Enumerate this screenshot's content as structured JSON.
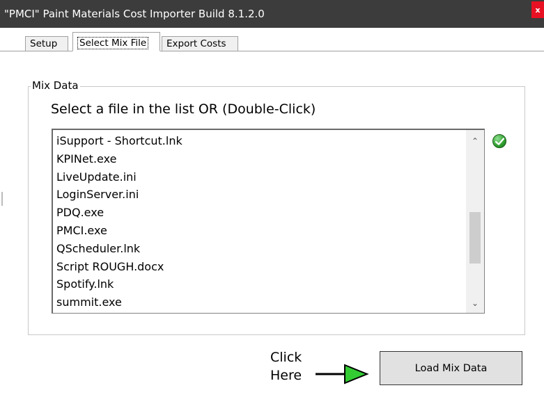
{
  "window": {
    "title": "\"PMCI\" Paint Materials Cost Importer   Build 8.1.2.0",
    "close_label": "x"
  },
  "tabs": [
    {
      "label": "Setup"
    },
    {
      "label": "Select Mix File"
    },
    {
      "label": "Export Costs"
    }
  ],
  "mix_data": {
    "group_label": "Mix Data",
    "instruction": "Select a file in the list OR (Double-Click)",
    "files": [
      "iSupport - Shortcut.lnk",
      "KPINet.exe",
      "LiveUpdate.ini",
      "LoginServer.ini",
      "PDQ.exe",
      "PMCI.exe",
      "QScheduler.lnk",
      "Script ROUGH.docx",
      "Spotify.lnk",
      "summit.exe"
    ],
    "status_icon": "green-check-icon"
  },
  "hint": {
    "line1": "Click",
    "line2": "Here",
    "arrow_color": "#33cc33"
  },
  "load_button": {
    "label": "Load Mix Data"
  },
  "colors": {
    "titlebar": "#3c3c3c",
    "close": "#e81123",
    "accent_green": "#2e9e2e"
  }
}
